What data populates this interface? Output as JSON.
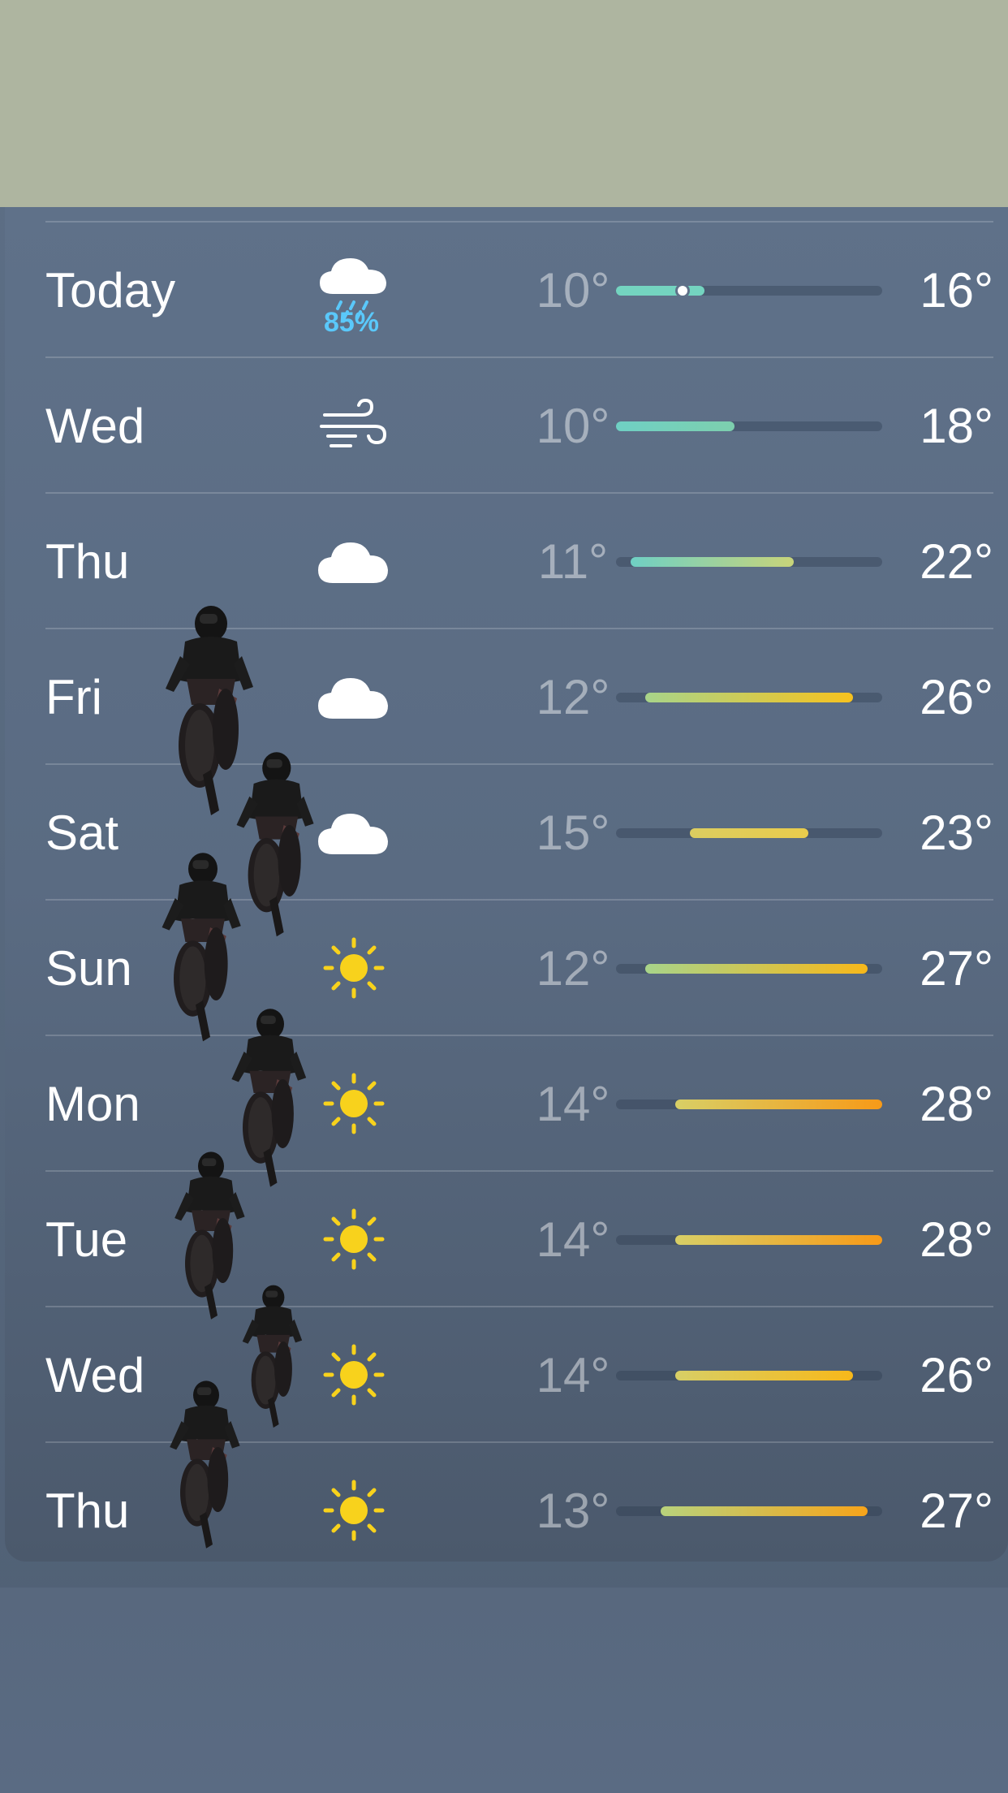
{
  "forecast": [
    {
      "day": "Today",
      "icon": "rain-cloud-icon",
      "precip": "85%",
      "low": "10°",
      "high": "16°",
      "low_val": 10,
      "high_val": 16,
      "current": 14.5,
      "colors": [
        "#74d4c0",
        "#74d4c0"
      ]
    },
    {
      "day": "Wed",
      "icon": "wind-icon",
      "precip": "",
      "low": "10°",
      "high": "18°",
      "low_val": 10,
      "high_val": 18,
      "colors": [
        "#6fd0c4",
        "#7dcfae"
      ]
    },
    {
      "day": "Thu",
      "icon": "cloud-icon",
      "precip": "",
      "low": "11°",
      "high": "22°",
      "low_val": 11,
      "high_val": 22,
      "colors": [
        "#6fd0c4",
        "#c8d47a"
      ]
    },
    {
      "day": "Fri",
      "icon": "cloud-icon",
      "precip": "",
      "low": "12°",
      "high": "26°",
      "low_val": 12,
      "high_val": 26,
      "colors": [
        "#a8d48a",
        "#f7c21e"
      ]
    },
    {
      "day": "Sat",
      "icon": "cloud-icon",
      "precip": "",
      "low": "15°",
      "high": "23°",
      "low_val": 15,
      "high_val": 23,
      "colors": [
        "#dccd60",
        "#e9cc4c"
      ]
    },
    {
      "day": "Sun",
      "icon": "sun-icon",
      "precip": "",
      "low": "12°",
      "high": "27°",
      "low_val": 12,
      "high_val": 27,
      "colors": [
        "#a8d48a",
        "#f7b81a"
      ]
    },
    {
      "day": "Mon",
      "icon": "sun-icon",
      "precip": "",
      "low": "14°",
      "high": "28°",
      "low_val": 14,
      "high_val": 28,
      "colors": [
        "#d8cf66",
        "#f79a18"
      ]
    },
    {
      "day": "Tue",
      "icon": "sun-icon",
      "precip": "",
      "low": "14°",
      "high": "28°",
      "low_val": 14,
      "high_val": 28,
      "colors": [
        "#d8cf66",
        "#f79a18"
      ]
    },
    {
      "day": "Wed",
      "icon": "sun-icon",
      "precip": "",
      "low": "14°",
      "high": "26°",
      "low_val": 14,
      "high_val": 26,
      "colors": [
        "#d8cf66",
        "#f7b81a"
      ]
    },
    {
      "day": "Thu",
      "icon": "sun-icon",
      "precip": "",
      "low": "13°",
      "high": "27°",
      "low_val": 13,
      "high_val": 27,
      "colors": [
        "#b8d27c",
        "#f7a41a"
      ]
    }
  ],
  "range": {
    "min": 10,
    "max": 28
  },
  "colors": {
    "sun": "#f8d21c",
    "cloud": "#ffffff",
    "precip": "#5ac8fa"
  }
}
